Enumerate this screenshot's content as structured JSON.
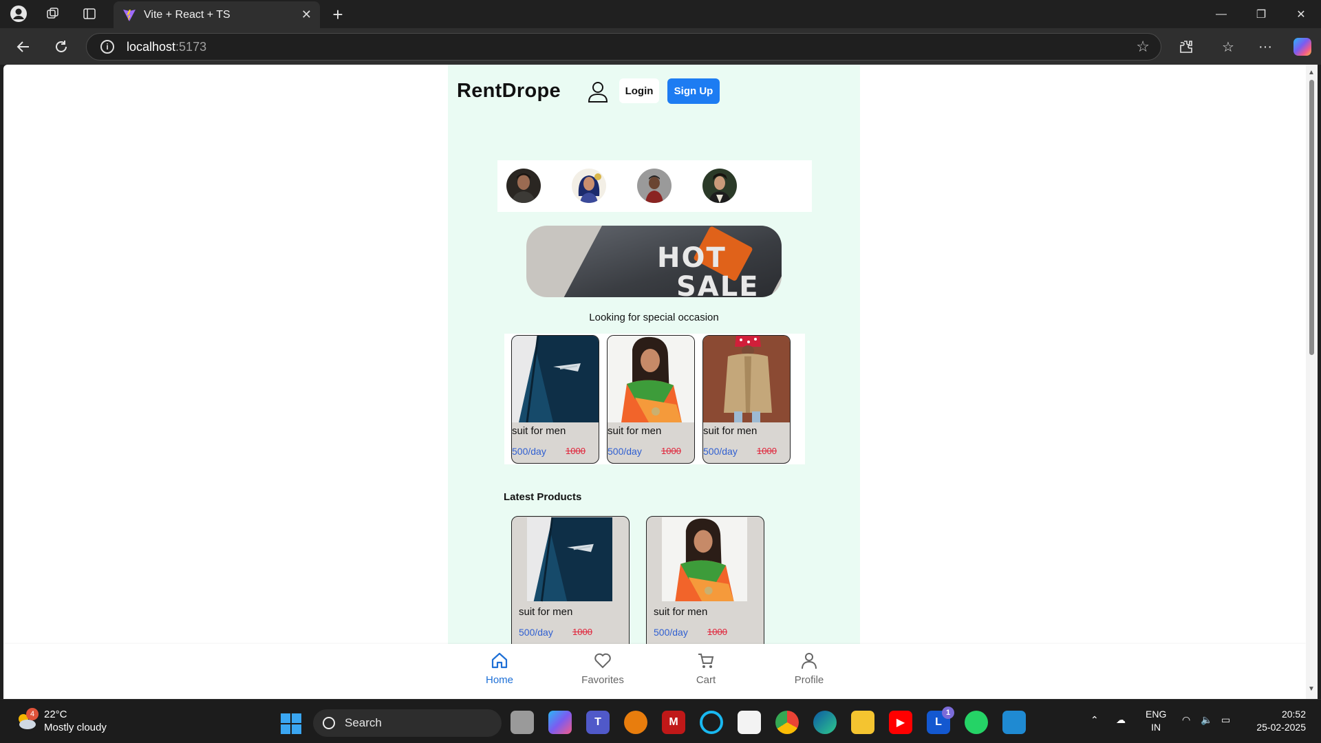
{
  "browser": {
    "tab_title": "Vite + React + TS",
    "url_host": "localhost",
    "url_port": ":5173"
  },
  "app": {
    "brand": "RentDrope",
    "login_label": "Login",
    "signup_label": "Sign Up",
    "banner_text_1": "HOT",
    "banner_text_2": "SALE",
    "section_text": "Looking for special occasion",
    "occasion_products": [
      {
        "title": "suit for men",
        "price": "500/day",
        "mrp": "1000"
      },
      {
        "title": "suit for men",
        "price": "500/day",
        "mrp": "1000"
      },
      {
        "title": "suit for men",
        "price": "500/day",
        "mrp": "1000"
      }
    ],
    "latest_title": "Latest Products",
    "latest_products": [
      {
        "title": "suit for men",
        "price": "500/day",
        "mrp": "1000"
      },
      {
        "title": "suit for men",
        "price": "500/day",
        "mrp": "1000"
      }
    ],
    "bottom_nav": [
      {
        "label": "Home",
        "icon": "home-icon",
        "active": true
      },
      {
        "label": "Favorites",
        "icon": "heart-icon",
        "active": false
      },
      {
        "label": "Cart",
        "icon": "cart-icon",
        "active": false
      },
      {
        "label": "Profile",
        "icon": "profile-icon",
        "active": false
      }
    ],
    "colors": {
      "accent": "#1d7cf2",
      "page_bg": "#eafbf3",
      "price": "#2f5fd1",
      "mrp": "#e0243a"
    }
  },
  "taskbar": {
    "temperature": "22°C",
    "weather": "Mostly cloudy",
    "weather_badge": "4",
    "search_placeholder": "Search",
    "lang_1": "ENG",
    "lang_2": "IN",
    "time": "20:52",
    "date": "25-02-2025",
    "l_badge": "1"
  }
}
